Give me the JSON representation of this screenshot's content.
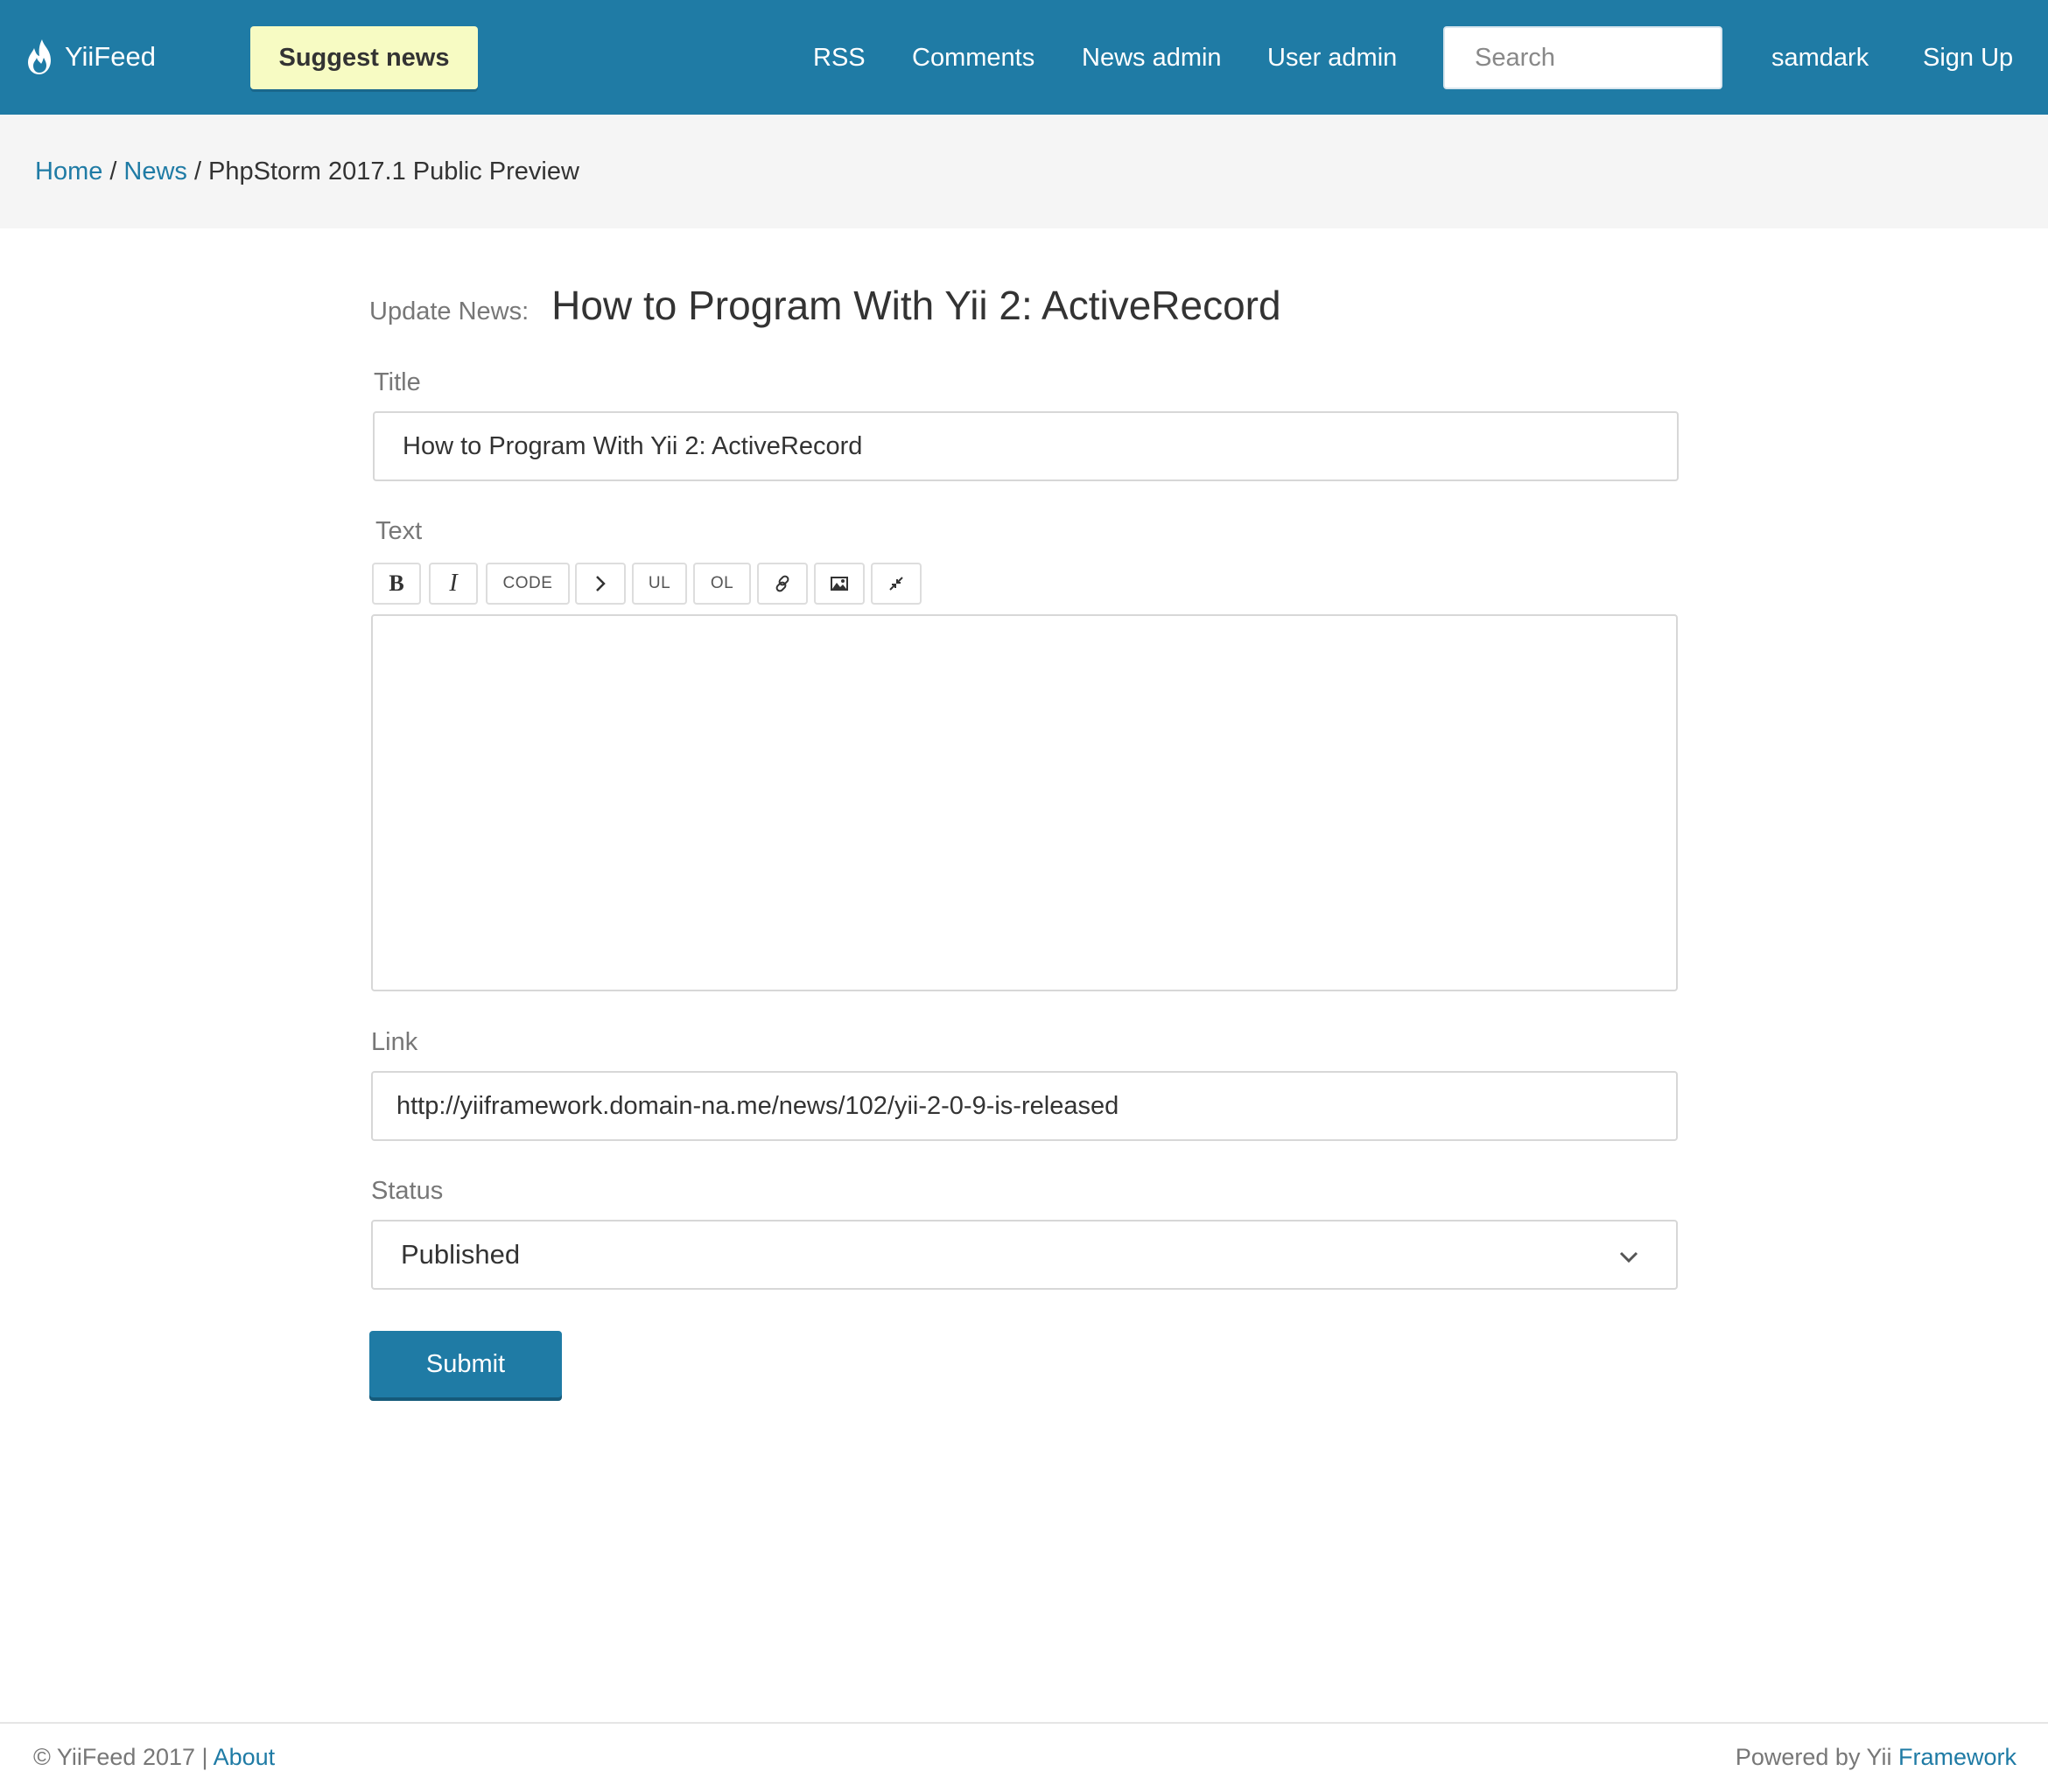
{
  "navbar": {
    "brand": "YiiFeed",
    "suggest_label": "Suggest news",
    "links": [
      "RSS",
      "Comments",
      "News admin",
      "User admin"
    ],
    "search_placeholder": "Search",
    "user": "samdark",
    "signup": "Sign Up",
    "bg_color": "#1f7ba5",
    "suggest_color": "#f7fbc3"
  },
  "breadcrumb": {
    "items": [
      "Home",
      "News"
    ],
    "separator": "/",
    "current": "PhpStorm 2017.1 Public Preview"
  },
  "form": {
    "header_prefix": "Update News:",
    "header_title": "How to Program With Yii 2: ActiveRecord",
    "title_label": "Title",
    "title_value": "How to Program With Yii 2: ActiveRecord",
    "text_label": "Text",
    "toolbar": {
      "bold": "B",
      "italic": "I",
      "code": "CODE",
      "quote_icon": "chevron-right-icon",
      "ul": "UL",
      "ol": "OL",
      "link_icon": "link-icon",
      "image_icon": "image-icon",
      "fullscreen_icon": "collapse-icon"
    },
    "text_value": "",
    "link_label": "Link",
    "link_value": "http://yiiframework.domain-na.me/news/102/yii-2-0-9-is-released",
    "status_label": "Status",
    "status_value": "Published",
    "submit_label": "Submit"
  },
  "footer": {
    "copyright": "© YiiFeed 2017 |",
    "about": "About",
    "powered_prefix": "Powered by Yii",
    "powered_link": "Framework"
  }
}
